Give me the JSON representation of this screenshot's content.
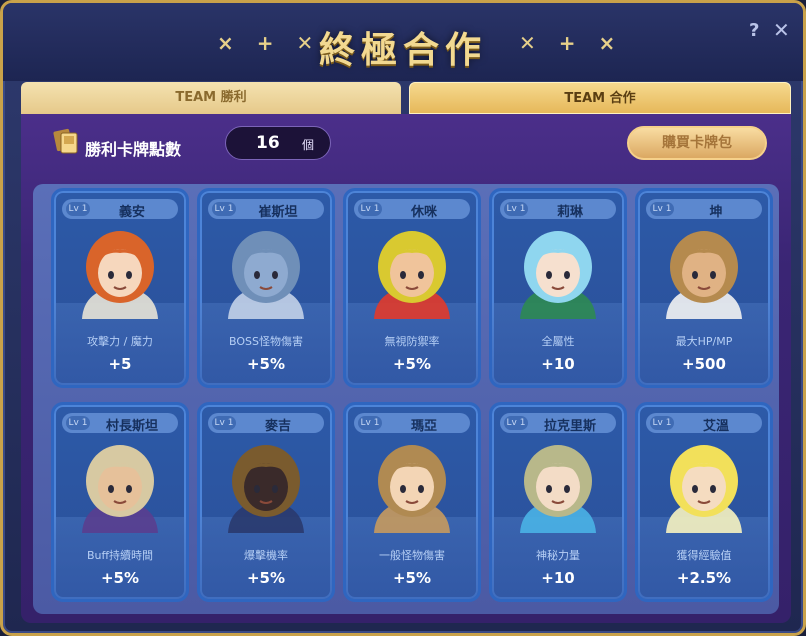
{
  "window": {
    "title": "終極合作",
    "decor_left": "× + ✕",
    "decor_right": "✕ + ×",
    "help": "?",
    "close": "✕"
  },
  "tabs": [
    {
      "label": "TEAM 勝利",
      "active": false
    },
    {
      "label": "TEAM 合作",
      "active": true
    }
  ],
  "points": {
    "label": "勝利卡牌點數",
    "value": "16",
    "unit": "個"
  },
  "buy_button": "購買卡牌包",
  "cards": [
    {
      "level": "Lv 1",
      "name": "義安",
      "stat": "攻擊力 / 魔力",
      "value": "+5",
      "portrait": "archer-girl"
    },
    {
      "level": "Lv 1",
      "name": "崔斯坦",
      "stat": "BOSS怪物傷害",
      "value": "+5%",
      "portrait": "armored-knight"
    },
    {
      "level": "Lv 1",
      "name": "休咪",
      "stat": "無視防禦率",
      "value": "+5%",
      "portrait": "red-cap-girl"
    },
    {
      "level": "Lv 1",
      "name": "莉琳",
      "stat": "全屬性",
      "value": "+10",
      "portrait": "blue-hair-girl"
    },
    {
      "level": "Lv 1",
      "name": "坤",
      "stat": "最大HP/MP",
      "value": "+500",
      "portrait": "viking-warrior"
    },
    {
      "level": "Lv 1",
      "name": "村長斯坦",
      "stat": "Buff持續時間",
      "value": "+5%",
      "portrait": "old-chief"
    },
    {
      "level": "Lv 1",
      "name": "麥吉",
      "stat": "爆擊機率",
      "value": "+5%",
      "portrait": "straw-hat-ninja"
    },
    {
      "level": "Lv 1",
      "name": "瑪亞",
      "stat": "一般怪物傷害",
      "value": "+5%",
      "portrait": "hooded-girl"
    },
    {
      "level": "Lv 1",
      "name": "拉克里斯",
      "stat": "神秘力量",
      "value": "+10",
      "portrait": "elf-mage"
    },
    {
      "level": "Lv 1",
      "name": "艾溫",
      "stat": "獲得經驗值",
      "value": "+2.5%",
      "portrait": "blonde-fairy"
    }
  ],
  "colors": {
    "accent_gold": "#f2d991",
    "card_blue": "#2d5aa8",
    "panel_purple": "#3a2574"
  }
}
